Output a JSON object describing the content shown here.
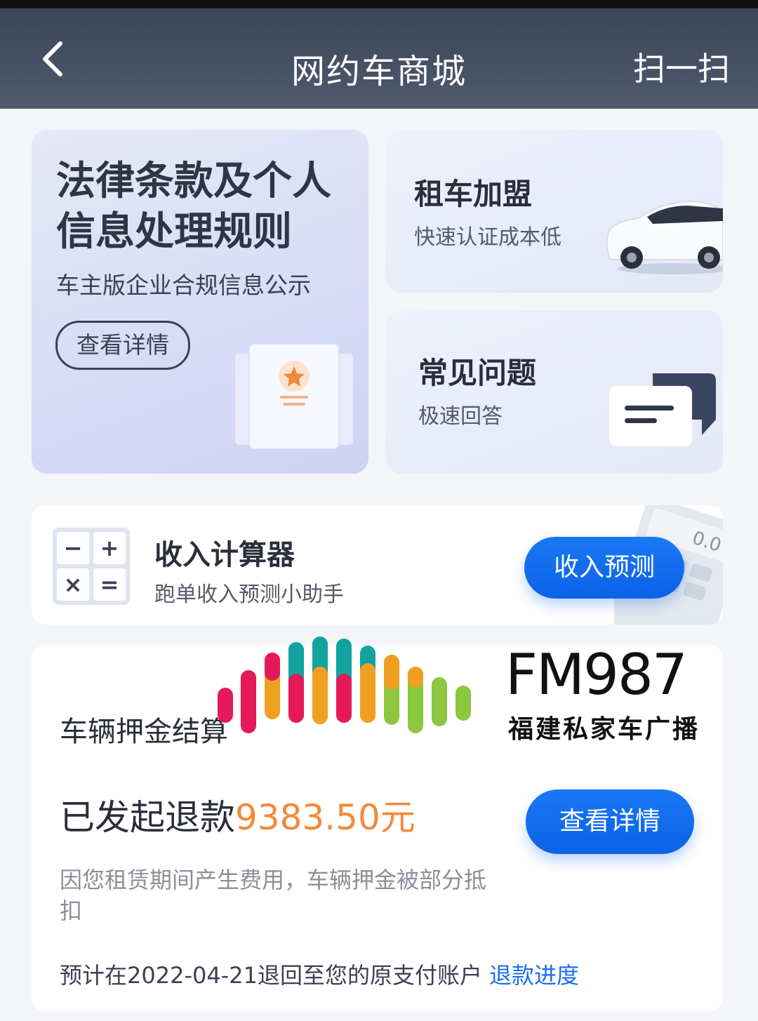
{
  "header": {
    "title": "网约车商城",
    "scan_label": "扫一扫"
  },
  "legal_card": {
    "title": "法律条款及个人信息处理规则",
    "subtitle": "车主版企业合规信息公示",
    "button_label": "查看详情"
  },
  "rent_card": {
    "title": "租车加盟",
    "subtitle": "快速认证成本低"
  },
  "faq_card": {
    "title": "常见问题",
    "subtitle": "极速回答"
  },
  "calculator": {
    "title": "收入计算器",
    "subtitle": "跑单收入预测小助手",
    "button_label": "收入预测",
    "keys": [
      "−",
      "+",
      "×",
      "="
    ],
    "screen_text": "0.0"
  },
  "deposit": {
    "title": "车辆押金结算",
    "refund_prefix": "已发起退款",
    "refund_amount": "9383.50元",
    "button_label": "查看详情",
    "note": "因您租赁期间产生费用，车辆押金被部分抵扣",
    "footer": "预计在2022-04-21退回至您的原支付账户",
    "footer_link": "退款进度"
  },
  "watermark": {
    "brand": "FM987",
    "station": "福建私家车广播"
  },
  "colors": {
    "header_bg": "#444e62",
    "accent_blue": "#1a6ef0",
    "amount_orange": "#f28a3c"
  }
}
